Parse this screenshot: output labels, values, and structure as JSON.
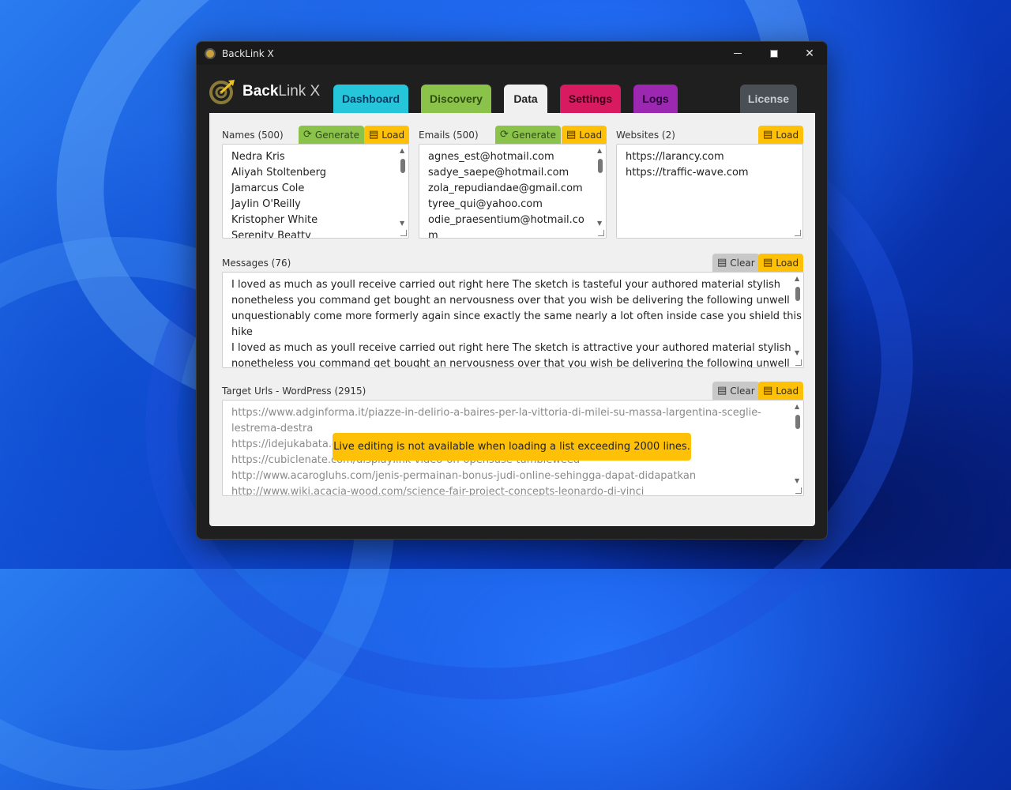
{
  "window": {
    "title": "BackLink X",
    "controls": {
      "minimize": "—",
      "maximize": "",
      "close": "✕"
    }
  },
  "brand": {
    "bold": "Back",
    "light": "Link X"
  },
  "tabs": [
    {
      "label": "Dashboard",
      "bg": "#26c6da",
      "fg": "#0b3a66"
    },
    {
      "label": "Discovery",
      "bg": "#8bc34a",
      "fg": "#2f4d12"
    },
    {
      "label": "Data",
      "bg": "#f0f0f0",
      "fg": "#222222"
    },
    {
      "label": "Settings",
      "bg": "#d81b60",
      "fg": "#3b0018"
    },
    {
      "label": "Logs",
      "bg": "#9c27b0",
      "fg": "#250033"
    },
    {
      "label": "License",
      "bg": "#4a4f55",
      "fg": "#c9ccd0"
    }
  ],
  "names": {
    "label": "Names (500)",
    "generate": "Generate",
    "load": "Load",
    "lines": [
      "Nedra Kris",
      "Aliyah Stoltenberg",
      "Jamarcus Cole",
      "Jaylin O'Reilly",
      "Kristopher White",
      "Serenity Beatty"
    ]
  },
  "emails": {
    "label": "Emails (500)",
    "generate": "Generate",
    "load": "Load",
    "lines": [
      "agnes_est@hotmail.com",
      "sadye_saepe@hotmail.com",
      "zola_repudiandae@gmail.com",
      "tyree_qui@yahoo.com",
      "odie_praesentium@hotmail.co",
      "m"
    ]
  },
  "websites": {
    "label": "Websites (2)",
    "load": "Load",
    "lines": [
      "https://larancy.com",
      "https://traffic-wave.com"
    ]
  },
  "messages": {
    "label": "Messages (76)",
    "clear": "Clear",
    "load": "Load",
    "lines": [
      "I loved as much as youll receive carried out right here The sketch is tasteful your authored material stylish",
      "nonetheless you command get bought an nervousness over that you wish be delivering the following unwell",
      "unquestionably come more formerly again since exactly the same nearly a lot often inside case you shield this",
      "hike",
      "I loved as much as youll receive carried out right here The sketch is attractive your authored material stylish",
      "nonetheless you command get bought an nervousness over that you wish be delivering the following unwell"
    ]
  },
  "targets": {
    "label": "Target Urls - WordPress (2915)",
    "clear": "Clear",
    "load": "Load",
    "lines": [
      "https://www.adginforma.it/piazze-in-delirio-a-baires-per-la-vittoria-di-milei-su-massa-largentina-sceglie-",
      "lestrema-destra",
      "https://idejukabata.e                                                                                       -un-labklajibu",
      "https://cubiclenate.com/displaylink-video-on-opensuse-tumbleweed",
      "http://www.acarogluhs.com/jenis-permainan-bonus-judi-online-sehingga-dapat-didapatkan",
      "http://www.wiki.acacia-wood.com/science-fair-project-concepts-leonardo-di-vinci"
    ]
  },
  "toast": "Live editing is not available when loading a list exceeding 2000 lines."
}
